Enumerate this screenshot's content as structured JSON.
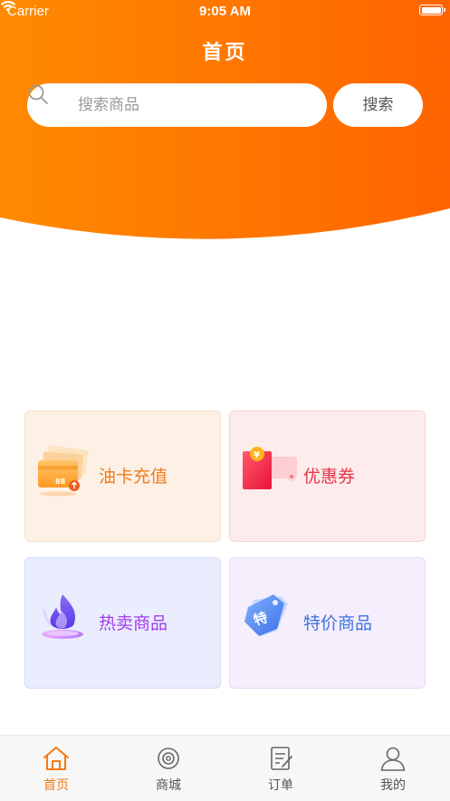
{
  "status_bar": {
    "carrier": "Carrier",
    "time": "9:05 AM"
  },
  "header": {
    "title": "首页"
  },
  "search": {
    "placeholder": "搜索商品",
    "value": "",
    "button_label": "搜索"
  },
  "cards": [
    {
      "label": "油卡充值",
      "icon": "fuel-card-icon",
      "badge": "88"
    },
    {
      "label": "优惠券",
      "icon": "coupon-icon",
      "badge": "¥"
    },
    {
      "label": "热卖商品",
      "icon": "flame-icon"
    },
    {
      "label": "特价商品",
      "icon": "tag-icon",
      "badge": "特"
    }
  ],
  "tabbar": {
    "active_index": 0,
    "items": [
      {
        "label": "首页",
        "icon": "home-icon"
      },
      {
        "label": "商城",
        "icon": "mall-icon"
      },
      {
        "label": "订单",
        "icon": "order-icon"
      },
      {
        "label": "我的",
        "icon": "user-icon"
      }
    ]
  },
  "colors": {
    "header_gradient_start": "#ff8a00",
    "header_gradient_end": "#ff6a00",
    "accent": "#f57a10"
  }
}
